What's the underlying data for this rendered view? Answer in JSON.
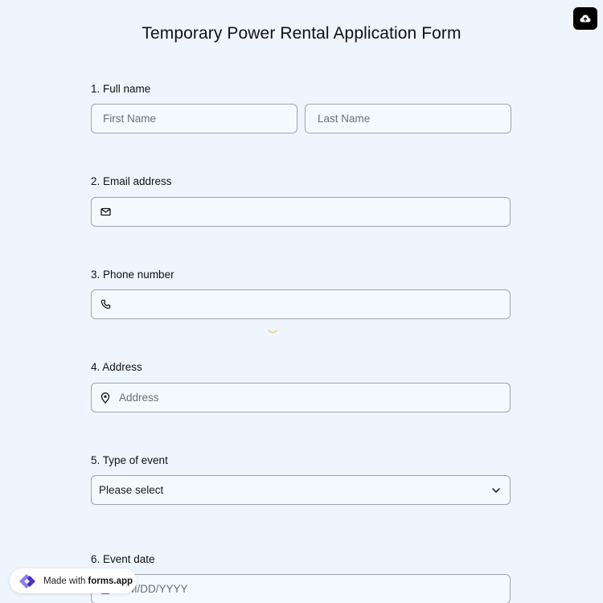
{
  "form": {
    "title": "Temporary Power Rental Application Form"
  },
  "questions": [
    {
      "label": "1.  Full name",
      "first_placeholder": "First Name",
      "last_placeholder": "Last Name"
    },
    {
      "label": "2. Email address",
      "icon": "envelope-icon"
    },
    {
      "label": "3. Phone number",
      "icon": "phone-icon"
    },
    {
      "label": "4. Address",
      "icon": "map-pin-icon",
      "placeholder": "Address"
    },
    {
      "label": "5. Type of event",
      "selected": "Please select"
    },
    {
      "label": "6. Event date",
      "icon": "calendar-icon",
      "placeholder": "MM/DD/YYYY"
    }
  ],
  "toolbar": {
    "upload_icon": "cloud-upload-icon"
  },
  "badge": {
    "made_with": "Made with",
    "brand": "forms.app"
  },
  "colors": {
    "background": "#eef5fd",
    "field_border": "#9ea4ab",
    "brand_purple": "#6b4de6"
  }
}
